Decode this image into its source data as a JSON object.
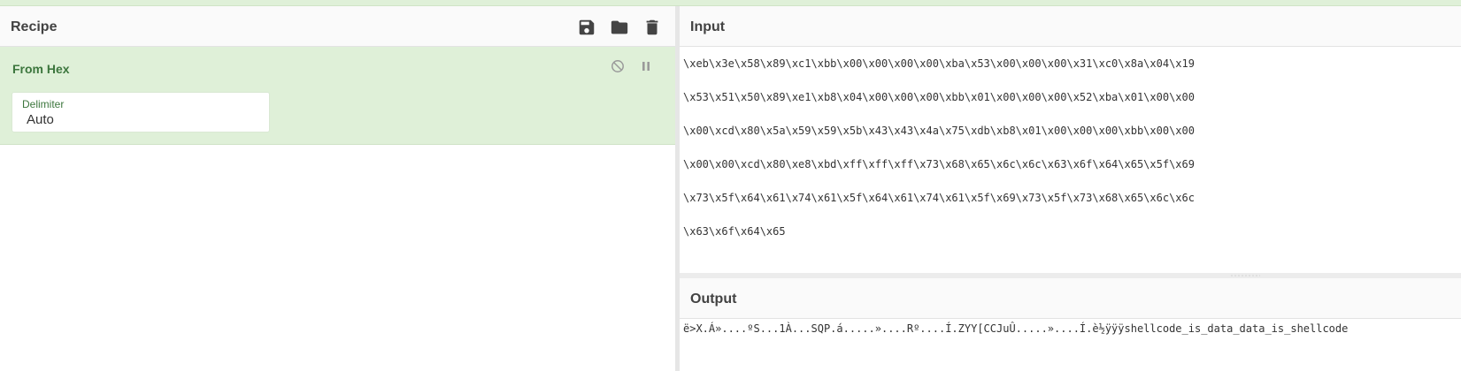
{
  "recipe": {
    "title": "Recipe",
    "icons": [
      "save-icon",
      "folder-icon",
      "trash-icon"
    ],
    "operation": {
      "name": "From Hex",
      "controls": [
        "disable-icon",
        "pause-icon"
      ],
      "delimiter_label": "Delimiter",
      "delimiter_value": "Auto"
    }
  },
  "input": {
    "title": "Input",
    "lines": [
      "\\xeb\\x3e\\x58\\x89\\xc1\\xbb\\x00\\x00\\x00\\x00\\xba\\x53\\x00\\x00\\x00\\x31\\xc0\\x8a\\x04\\x19",
      "\\x53\\x51\\x50\\x89\\xe1\\xb8\\x04\\x00\\x00\\x00\\xbb\\x01\\x00\\x00\\x00\\x52\\xba\\x01\\x00\\x00",
      "\\x00\\xcd\\x80\\x5a\\x59\\x59\\x5b\\x43\\x43\\x4a\\x75\\xdb\\xb8\\x01\\x00\\x00\\x00\\xbb\\x00\\x00",
      "\\x00\\x00\\xcd\\x80\\xe8\\xbd\\xff\\xff\\xff\\x73\\x68\\x65\\x6c\\x6c\\x63\\x6f\\x64\\x65\\x5f\\x69",
      "\\x73\\x5f\\x64\\x61\\x74\\x61\\x5f\\x64\\x61\\x74\\x61\\x5f\\x69\\x73\\x5f\\x73\\x68\\x65\\x6c\\x6c",
      "\\x63\\x6f\\x64\\x65"
    ]
  },
  "output": {
    "title": "Output",
    "text": "ë>X.Á»....ºS...1À...SQP.á.....»....Rº....Í.ZYY[CCJuÛ.....»....Í.è½ÿÿÿshellcode_is_data_data_is_shellcode"
  },
  "colors": {
    "operation_bg": "#dff0d8",
    "operation_title": "#3c763d"
  }
}
